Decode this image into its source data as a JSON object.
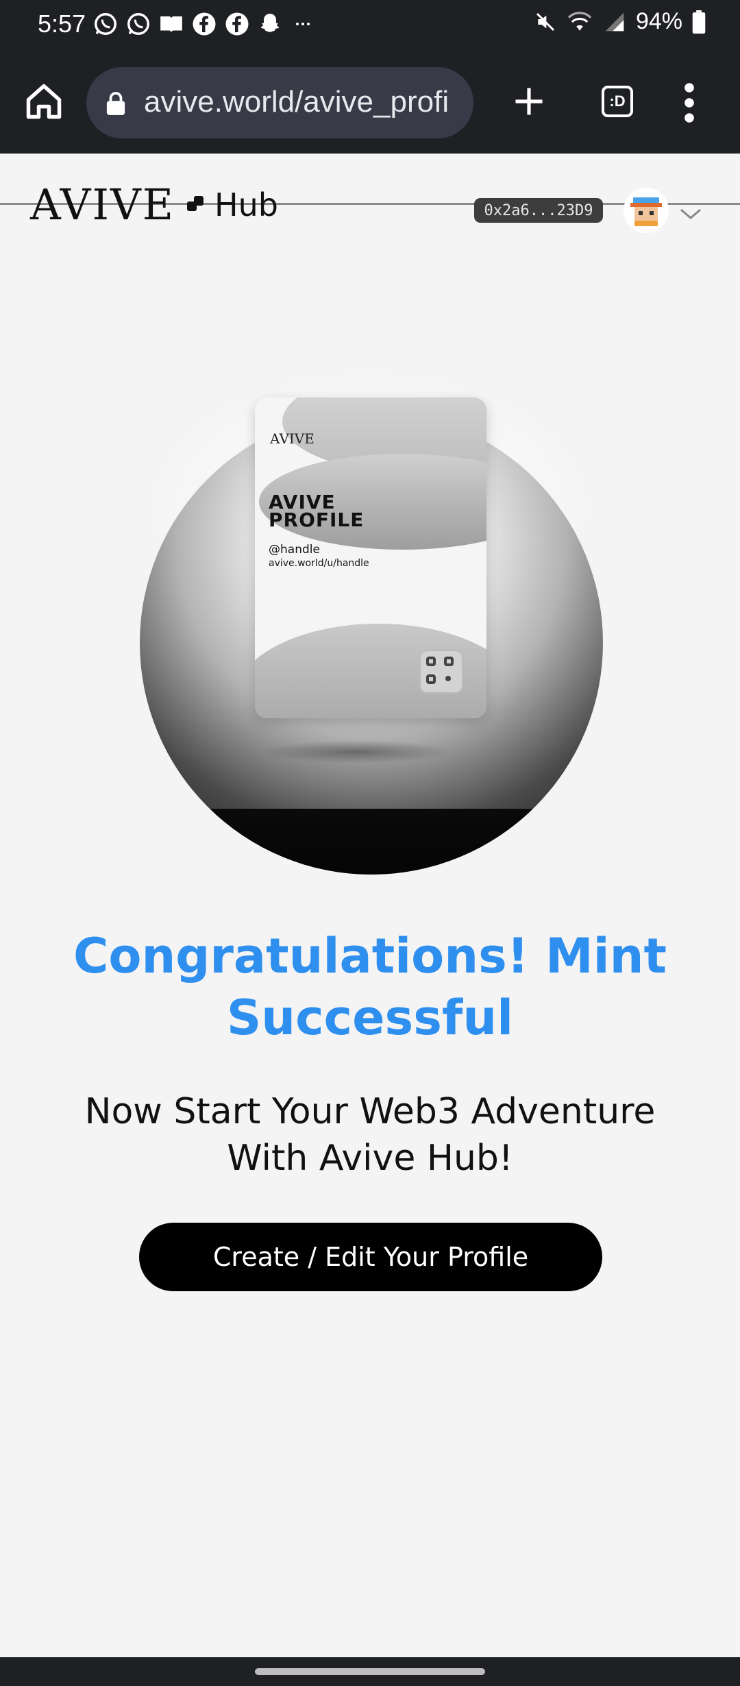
{
  "status_bar": {
    "time": "5:57",
    "battery": "94%",
    "notification_icons": [
      "whatsapp-icon",
      "whatsapp-icon",
      "book-icon",
      "facebook-icon",
      "facebook-icon",
      "snapchat-icon",
      "more-icon"
    ],
    "system_icons": [
      "mute-icon",
      "wifi-icon",
      "signal-icon",
      "battery-icon"
    ]
  },
  "browser": {
    "url": "avive.world/avive_profi",
    "tab_count": ":D"
  },
  "header": {
    "logo_text": "AVIVE",
    "hub_text": "Hub",
    "wallet_address": "0x2a6...23D9"
  },
  "card": {
    "brand": "AVIVE",
    "title": "AVIVE PROFILE",
    "handle": "@handle",
    "url": "avive.world/u/handle"
  },
  "content": {
    "headline": "Congratulations! Mint Successful",
    "subline": "Now Start Your Web3 Adventure With Avive Hub!",
    "cta_label": "Create / Edit Your Profile"
  },
  "colors": {
    "accent": "#2f8fef",
    "topbar": "#1f2024",
    "page_bg": "#f4f4f4",
    "button_bg": "#000000"
  }
}
